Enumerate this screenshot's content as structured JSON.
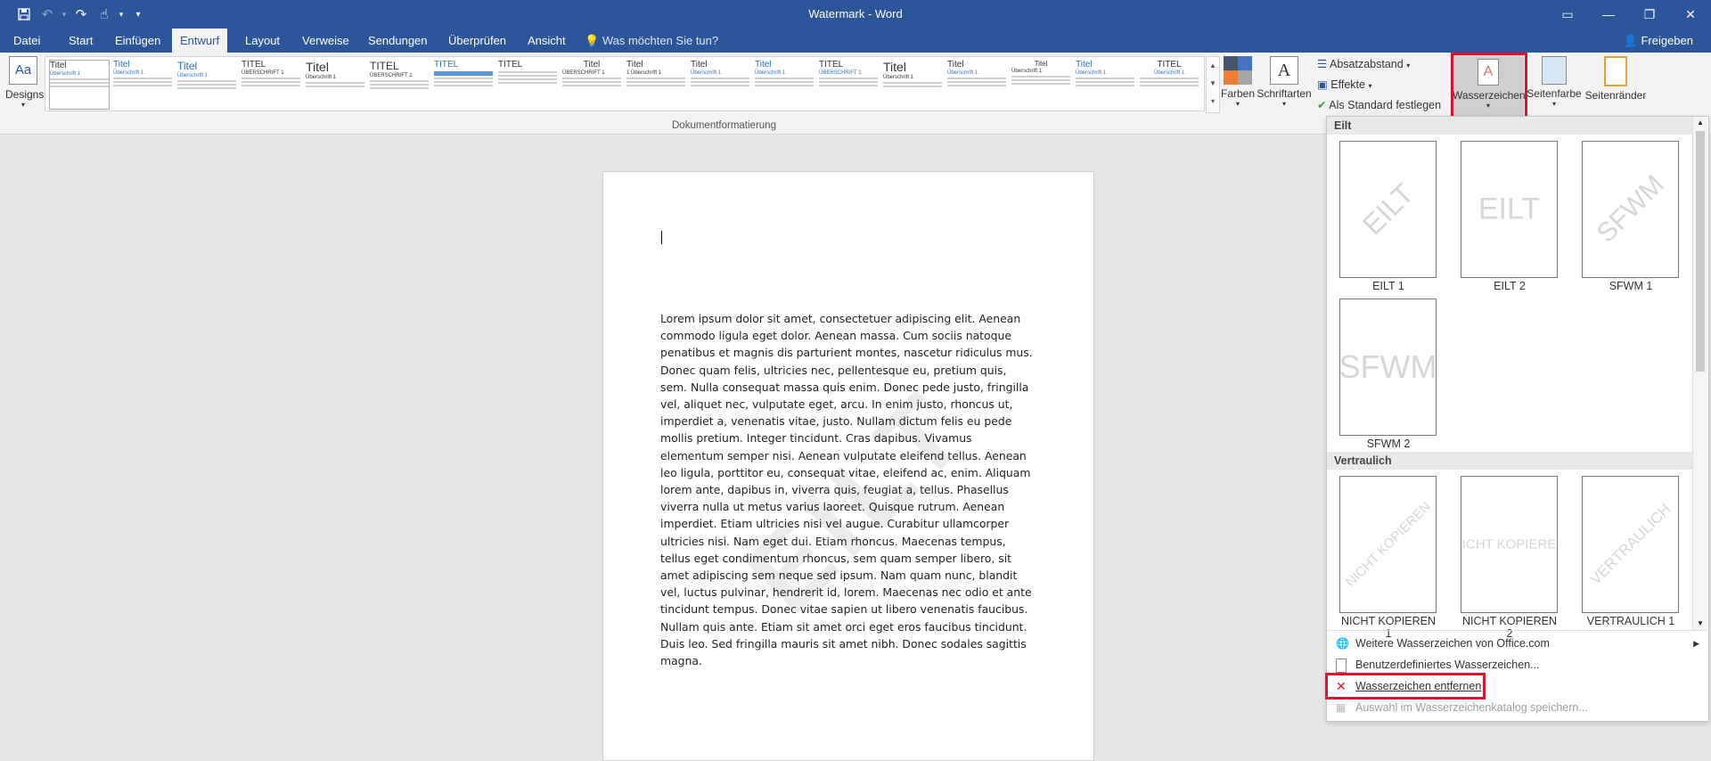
{
  "window": {
    "title": "Watermark - Word"
  },
  "quick_access": {
    "icons": [
      "save-icon",
      "undo-icon",
      "redo-icon",
      "touch-mode-icon",
      "customize-icon"
    ]
  },
  "tabs": [
    {
      "label": "Datei"
    },
    {
      "label": "Start"
    },
    {
      "label": "Einfügen"
    },
    {
      "label": "Entwurf"
    },
    {
      "label": "Layout"
    },
    {
      "label": "Verweise"
    },
    {
      "label": "Sendungen"
    },
    {
      "label": "Überprüfen"
    },
    {
      "label": "Ansicht"
    }
  ],
  "tell_me": {
    "placeholder": "Was möchten Sie tun?"
  },
  "share": {
    "label": "Freigeben"
  },
  "ribbon": {
    "designs_label": "Designs",
    "group_label": "Dokumentformatierung",
    "styles": [
      {
        "title": "Titel",
        "heading": "Überschrift 1"
      },
      {
        "title": "Titel",
        "heading": "Überschrift 1"
      },
      {
        "title": "Titel",
        "heading": "Überschrift 1"
      },
      {
        "title": "TITEL",
        "heading": "ÜBERSCHRIFT 1"
      },
      {
        "title": "Titel",
        "heading": "Überschrift 1"
      },
      {
        "title": "TITEL",
        "heading": "ÜBERSCHRIFT 1"
      },
      {
        "title": "TITEL",
        "heading": ""
      },
      {
        "title": "TITEL",
        "heading": ""
      },
      {
        "title": "Titel",
        "heading": "ÜBERSCHRIFT 1"
      },
      {
        "title": "Titel",
        "heading": "1 Überschrift 1"
      },
      {
        "title": "Titel",
        "heading": "Überschrift 1"
      },
      {
        "title": "Titel",
        "heading": "Überschrift 1"
      },
      {
        "title": "TITEL",
        "heading": "ÜBERSCHRIFT 1"
      },
      {
        "title": "Titel",
        "heading": "Überschrift 1"
      },
      {
        "title": "Titel",
        "heading": "Überschrift 1"
      },
      {
        "title": "Titel",
        "heading": "Überschrift 1"
      },
      {
        "title": "Titel",
        "heading": "Überschrift 1"
      },
      {
        "title": "TITEL",
        "heading": "Überschrift 1"
      }
    ],
    "farben_label": "Farben",
    "schriftarten_label": "Schriftarten",
    "absatzabstand_label": "Absatzabstand",
    "effekte_label": "Effekte",
    "standard_label": "Als Standard festlegen",
    "wasserzeichen_label": "Wasserzeichen",
    "seitenfarbe_label": "Seitenfarbe",
    "seitenraender_label": "Seitenränder"
  },
  "document": {
    "watermark": "EILT",
    "body": "Lorem ipsum dolor sit amet, consectetuer adipiscing elit. Aenean commodo ligula eget dolor. Aenean massa. Cum sociis natoque penatibus et magnis dis parturient montes, nascetur ridiculus mus. Donec quam felis, ultricies nec, pellentesque eu, pretium quis, sem. Nulla consequat massa quis enim. Donec pede justo, fringilla vel, aliquet nec, vulputate eget, arcu. In enim justo, rhoncus ut, imperdiet a, venenatis vitae, justo. Nullam dictum felis eu pede mollis pretium. Integer tincidunt. Cras dapibus. Vivamus elementum semper nisi. Aenean vulputate eleifend tellus. Aenean leo ligula, porttitor eu, consequat vitae, eleifend ac, enim. Aliquam lorem ante, dapibus in, viverra quis, feugiat a, tellus. Phasellus viverra nulla ut metus varius laoreet. Quisque rutrum. Aenean imperdiet. Etiam ultricies nisi vel augue. Curabitur ullamcorper ultricies nisi. Nam eget dui. Etiam rhoncus. Maecenas tempus, tellus eget condimentum rhoncus, sem quam semper libero, sit amet adipiscing sem neque sed ipsum. Nam quam nunc, blandit vel, luctus pulvinar, hendrerit id, lorem. Maecenas nec odio et ante tincidunt tempus. Donec vitae sapien ut libero venenatis faucibus. Nullam quis ante. Etiam sit amet orci eget eros faucibus tincidunt. Duis leo. Sed fringilla mauris sit amet nibh. Donec sodales sagittis magna."
  },
  "dropdown": {
    "section1": "Eilt",
    "section2": "Vertraulich",
    "tiles1": [
      {
        "text": "EILT",
        "caption": "EILT 1"
      },
      {
        "text": "EILT",
        "caption": "EILT 2"
      },
      {
        "text": "SFWM",
        "caption": "SFWM 1"
      },
      {
        "text": "SFWM",
        "caption": "SFWM 2"
      }
    ],
    "tiles2": [
      {
        "text": "NICHT KOPIEREN",
        "caption": "NICHT KOPIEREN 1"
      },
      {
        "text": "NICHT KOPIEREN",
        "caption": "NICHT KOPIEREN 2"
      },
      {
        "text": "VERTRAULICH",
        "caption": "VERTRAULICH 1"
      }
    ],
    "menu": [
      {
        "label": "Weitere Wasserzeichen von Office.com",
        "enabled": true
      },
      {
        "label": "Benutzerdefiniertes Wasserzeichen...",
        "enabled": true
      },
      {
        "label": "Wasserzeichen entfernen",
        "enabled": true
      },
      {
        "label": "Auswahl im Wasserzeichenkatalog speichern...",
        "enabled": false
      }
    ]
  },
  "colors": {
    "word_blue": "#2b579a",
    "highlight_red": "#e0112b"
  }
}
